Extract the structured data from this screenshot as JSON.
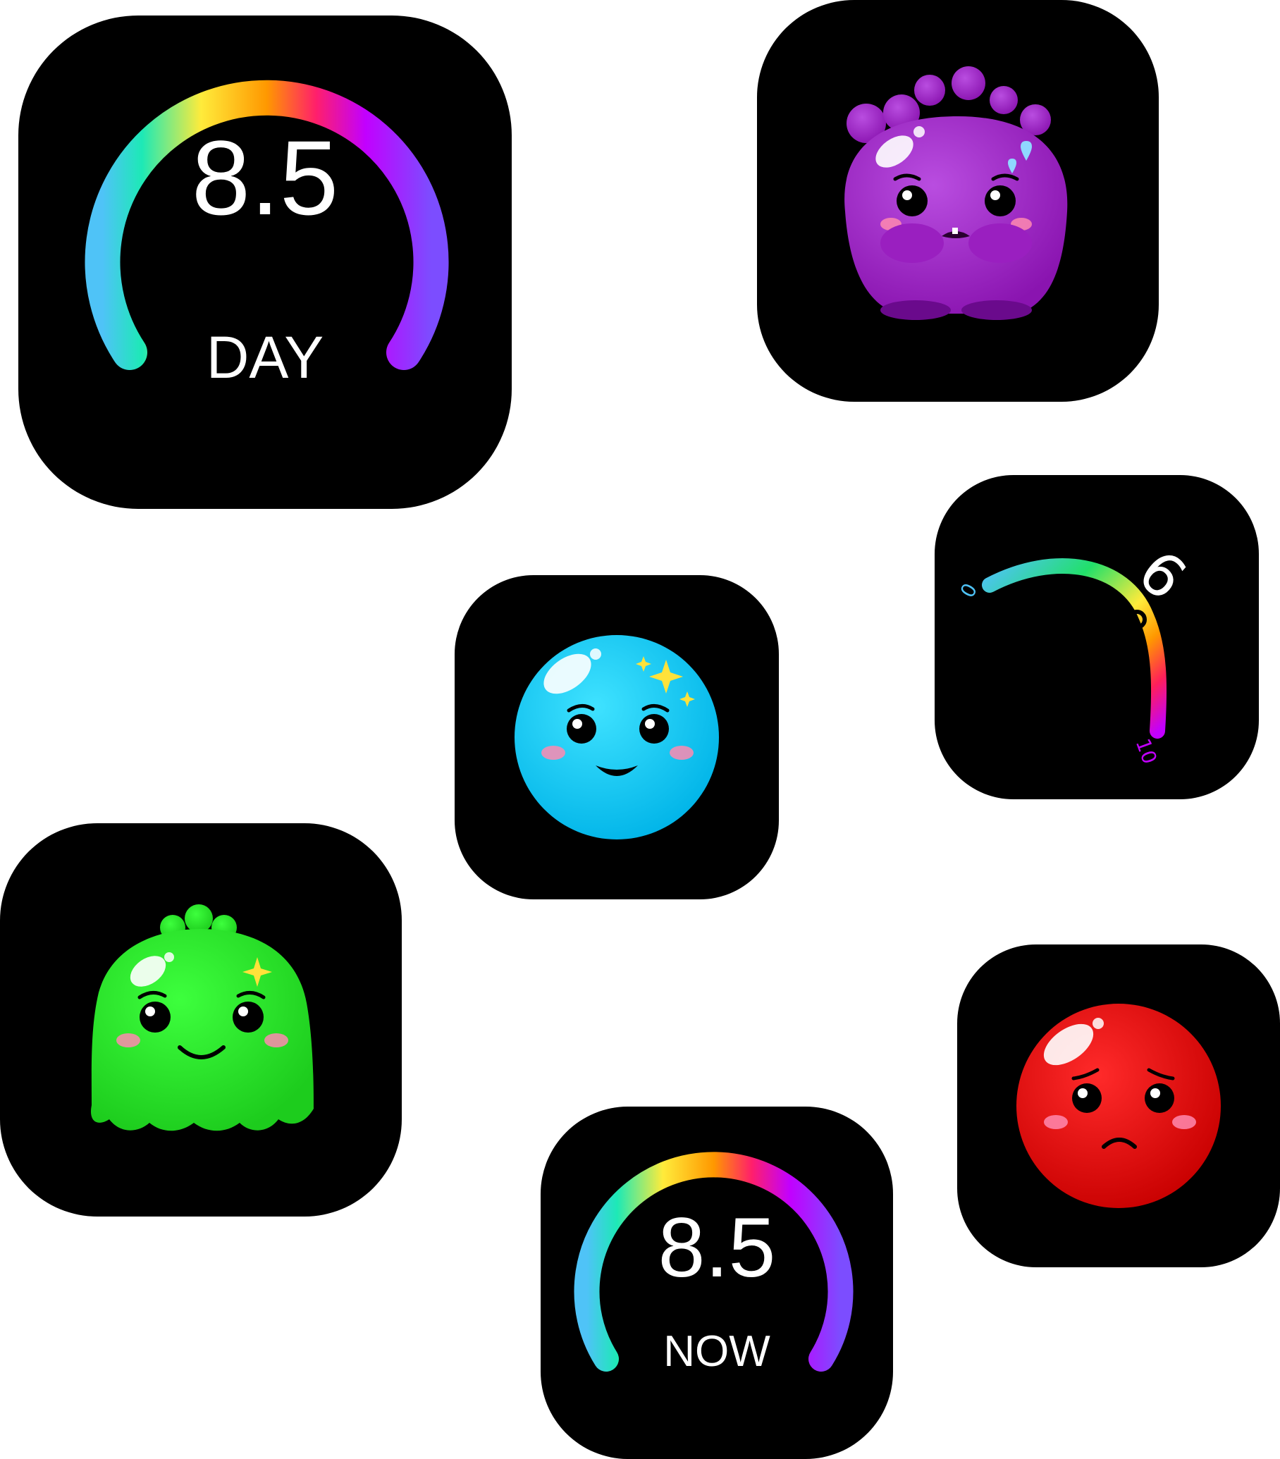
{
  "widgets": {
    "day_gauge": {
      "value": "8.5",
      "label": "DAY",
      "level": 0.85
    },
    "now_gauge": {
      "value": "8.5",
      "label": "NOW",
      "level": 0.85
    },
    "arc_gauge": {
      "value": "6",
      "min": "0",
      "max": "10",
      "level": 0.6
    }
  },
  "mascots": [
    {
      "name": "purple-monster",
      "mood": "scared",
      "color": "#a020c8"
    },
    {
      "name": "blue-ball",
      "mood": "happy",
      "color": "#00d2ff"
    },
    {
      "name": "green-monster",
      "mood": "happy",
      "color": "#22ee22"
    },
    {
      "name": "red-ball",
      "mood": "sad",
      "color": "#e00000"
    }
  ],
  "colors": {
    "tile_background": "#000000",
    "page_background": "#ffffff",
    "gauge_gradient": [
      "#4fc3f7",
      "#1de9b6",
      "#ffeb3b",
      "#ff9800",
      "#f44336",
      "#d500f9",
      "#7c4dff"
    ]
  }
}
